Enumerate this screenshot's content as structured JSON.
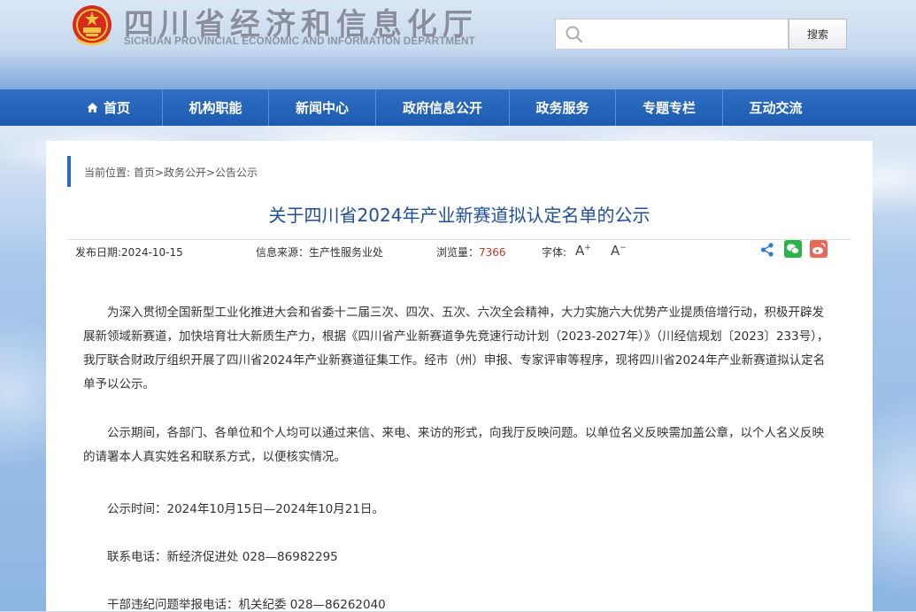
{
  "header": {
    "site_name_cn": "四川省经济和信息化厅",
    "site_name_en": "SICHUAN PROVINCIAL ECONOMIC AND INFORMATION DEPARTMENT",
    "search": {
      "placeholder": "",
      "button_label": "搜索"
    }
  },
  "nav": {
    "items": [
      {
        "label": "首页",
        "icon": "home-icon"
      },
      {
        "label": "机构职能"
      },
      {
        "label": "新闻中心"
      },
      {
        "label": "政府信息公开"
      },
      {
        "label": "政务服务"
      },
      {
        "label": "专题专栏"
      },
      {
        "label": "互动交流"
      }
    ]
  },
  "breadcrumb": {
    "prefix": "当前位置: ",
    "items": [
      "首页",
      "政务公开",
      "公告公示"
    ],
    "separator": ">"
  },
  "article": {
    "title": "关于四川省2024年产业新赛道拟认定名单的公示",
    "meta": {
      "publish_date": "发布日期:2024-10-15",
      "source": "信息来源：生产性服务业处",
      "views_label": "浏览量：",
      "views": "7366",
      "font_label": "字体:",
      "font_increase": "A",
      "font_decrease": "A"
    },
    "paragraphs": [
      "为深入贯彻全国新型工业化推进大会和省委十二届三次、四次、五次、六次全会精神，大力实施六大优势产业提质倍增行动，积极开辟发展新领域新赛道，加快培育壮大新质生产力，根据《四川省产业新赛道争先竞速行动计划（2023-2027年）》（川经信规划〔2023〕233号），我厅联合财政厅组织开展了四川省2024年产业新赛道征集工作。经市（州）申报、专家评审等程序，现将四川省2024年产业新赛道拟认定名单予以公示。",
      "公示期间，各部门、各单位和个人均可以通过来信、来电、来访的形式，向我厅反映问题。以单位名义反映需加盖公章，以个人名义反映的请署本人真实姓名和联系方式，以便核实情况。"
    ],
    "lines": [
      "公示时间：2024年10月15日—2024年10月21日。",
      "联系电话：新经济促进处  028—86982295",
      "干部违纪问题举报电话：机关纪委  028—86262040"
    ]
  },
  "colors": {
    "nav_bg": "#1d5bb0",
    "title": "#1f4e9a",
    "views": "#c0392b",
    "wechat": "#2bb24c",
    "weibo": "#e86a5b"
  }
}
